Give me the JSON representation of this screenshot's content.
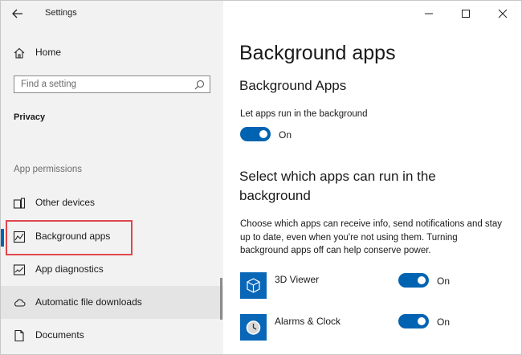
{
  "window": {
    "title": "Settings",
    "controls": [
      "minimize",
      "maximize",
      "close"
    ]
  },
  "sidebar": {
    "home_label": "Home",
    "search_placeholder": "Find a setting",
    "section_title": "Privacy",
    "permissions_header": "App permissions",
    "items": [
      {
        "label": "Other devices",
        "icon": "devices-icon"
      },
      {
        "label": "Background apps",
        "icon": "background-apps-icon",
        "selected": true
      },
      {
        "label": "App diagnostics",
        "icon": "diagnostics-icon"
      },
      {
        "label": "Automatic file downloads",
        "icon": "cloud-icon"
      },
      {
        "label": "Documents",
        "icon": "document-icon"
      }
    ]
  },
  "main": {
    "page_title": "Background apps",
    "subsection_title": "Background Apps",
    "let_apps_label": "Let apps run in the background",
    "master_toggle_state": "On",
    "select_title": "Select which apps can run in the background",
    "description": "Choose which apps can receive info, send notifications and stay up to date, even when you're not using them. Turning background apps off can help conserve power.",
    "apps": [
      {
        "name": "3D Viewer",
        "state": "On",
        "icon": "cube-icon"
      },
      {
        "name": "Alarms & Clock",
        "state": "On",
        "icon": "clock-icon"
      }
    ]
  },
  "colors": {
    "accent": "#0063b1",
    "sidebar_bg": "#f2f2f2",
    "highlight_border": "#e0474c"
  }
}
